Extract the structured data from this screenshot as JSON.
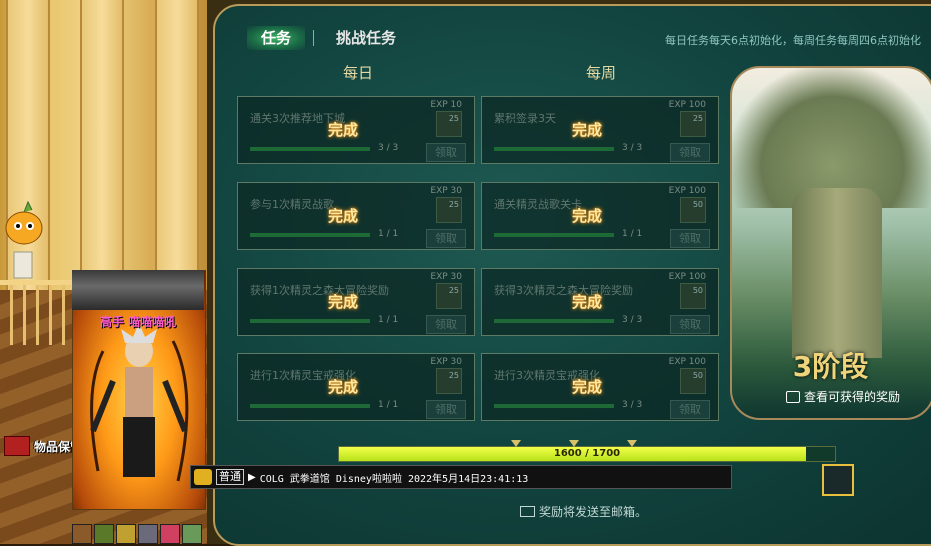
{
  "scene": {
    "character_name": "高手 喵喵喵吼",
    "warehouse_label": "物品保管箱"
  },
  "tabs": [
    {
      "label": "任务",
      "active": true
    },
    {
      "label": "挑战任务",
      "active": false
    }
  ],
  "reset_note": "每日任务每天6点初始化，每周任务每周四6点初始化",
  "columns": {
    "daily": "每日",
    "weekly": "每周"
  },
  "quests": {
    "daily": [
      {
        "name": "通关3次推荐地下城",
        "exp": "EXP 10",
        "reward": "25",
        "progress": "3 / 3",
        "claim": "领取",
        "status": "完成"
      },
      {
        "name": "参与1次精灵战歌",
        "exp": "EXP 30",
        "reward": "25",
        "progress": "1 / 1",
        "claim": "领取",
        "status": "完成"
      },
      {
        "name": "获得1次精灵之森大冒险奖励",
        "exp": "EXP 30",
        "reward": "25",
        "progress": "1 / 1",
        "claim": "领取",
        "status": "完成"
      },
      {
        "name": "进行1次精灵宝戒强化",
        "exp": "EXP 30",
        "reward": "25",
        "progress": "1 / 1",
        "claim": "领取",
        "status": "完成"
      }
    ],
    "weekly": [
      {
        "name": "累积签录3天",
        "exp": "EXP 100",
        "reward": "25",
        "progress": "3 / 3",
        "claim": "领取",
        "status": "完成"
      },
      {
        "name": "通关精灵战歌关卡",
        "exp": "EXP 100",
        "reward": "50",
        "progress": "1 / 1",
        "claim": "领取",
        "status": "完成"
      },
      {
        "name": "获得3次精灵之森大冒险奖励",
        "exp": "EXP 100",
        "reward": "50",
        "progress": "3 / 3",
        "claim": "领取",
        "status": "完成"
      },
      {
        "name": "进行3次精灵宝戒强化",
        "exp": "EXP 100",
        "reward": "50",
        "progress": "3 / 3",
        "claim": "领取",
        "status": "完成"
      }
    ]
  },
  "stage": {
    "label": "3阶段",
    "view_rewards": "查看可获得的奖励"
  },
  "progress": {
    "current": 1600,
    "max": 1700,
    "text": "1600 / 1700"
  },
  "chat": {
    "channel": "普通",
    "message": "COLG 武拳道馆 Disney啦啦啦 2022年5月14日23:41:13"
  },
  "mail_note": "奖励将发送至邮箱。",
  "colors": {
    "panel_bg": "#134641",
    "accent_gold": "#f0d47a",
    "progress_fill": "#b8e21a",
    "done_text": "#ffe8a0"
  }
}
